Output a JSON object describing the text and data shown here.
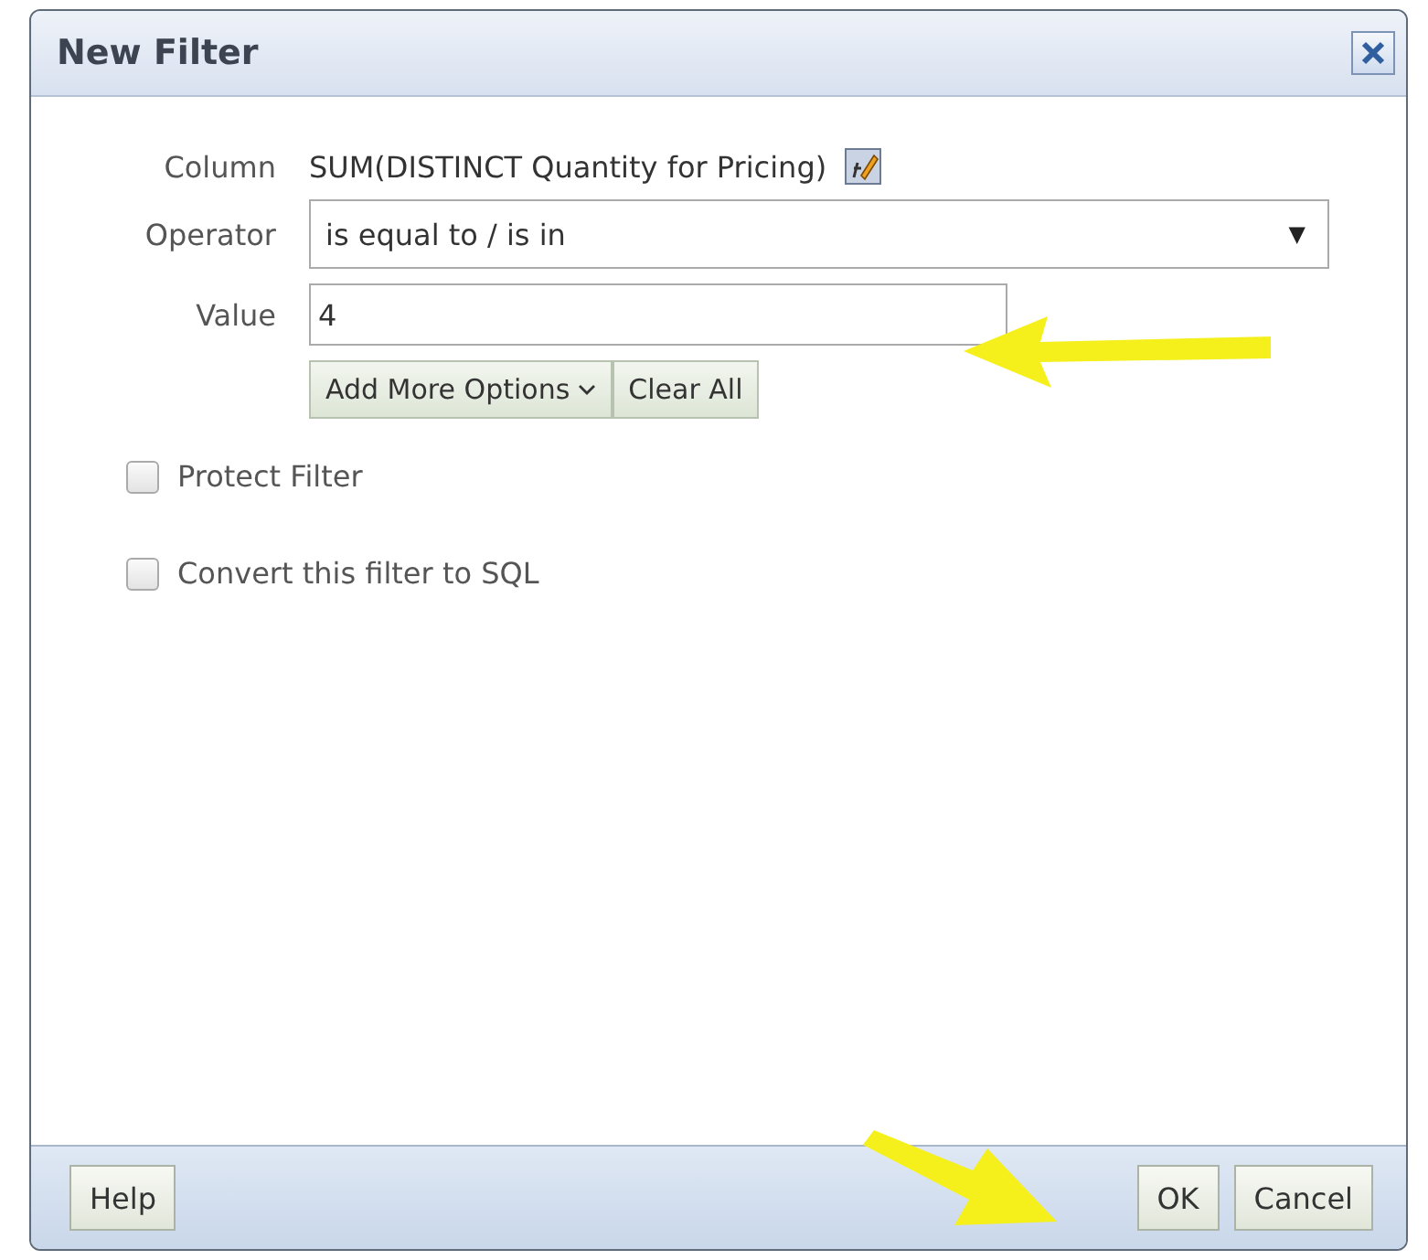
{
  "window": {
    "title": "New Filter"
  },
  "fields": {
    "column": {
      "label": "Column",
      "value": "SUM(DISTINCT Quantity for Pricing)"
    },
    "operator": {
      "label": "Operator",
      "value": "is equal to / is in",
      "arrow": "▼"
    },
    "value": {
      "label": "Value",
      "value": "4"
    }
  },
  "value_buttons": [
    {
      "label": "Add More Options",
      "dropdown": true
    },
    {
      "label": "Clear All",
      "dropdown": false
    }
  ],
  "checkboxes": [
    {
      "label": "Protect Filter",
      "checked": false
    },
    {
      "label": "Convert this filter to SQL",
      "checked": false
    }
  ],
  "footer": {
    "left_buttons": [
      "Help"
    ],
    "right_buttons": [
      "OK",
      "Cancel"
    ]
  }
}
